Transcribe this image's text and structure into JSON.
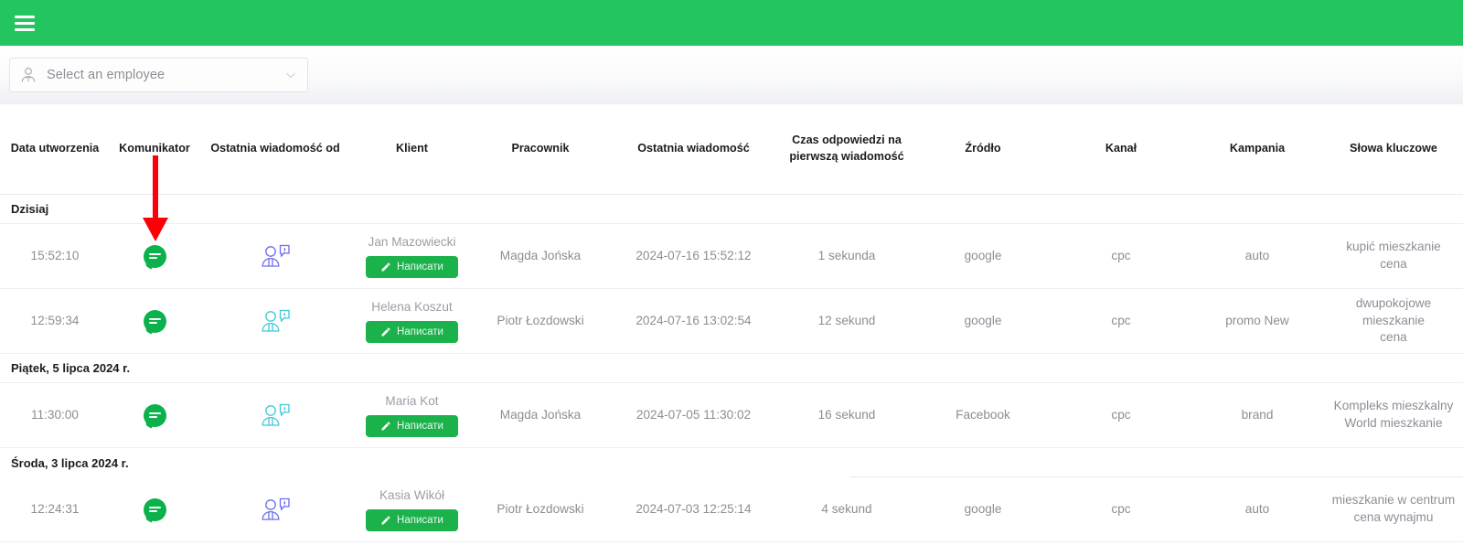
{
  "topbar": {
    "menu_icon": "hamburger-menu-icon"
  },
  "filter": {
    "employee_select": {
      "placeholder": "Select an employee",
      "icon": "employee-avatar-icon",
      "chevron": "chevron-down-icon"
    }
  },
  "table": {
    "headers": [
      "Data utworzenia",
      "Komunikator",
      "Ostatnia wiadomość od",
      "Klient",
      "Pracownik",
      "Ostatnia wiadomość",
      "Czas odpowiedzi na pierwszą wiadomość",
      "Źródło",
      "Kanał",
      "Kampania",
      "Słowa kluczowe"
    ],
    "write_button_label": "Написати",
    "groups": [
      {
        "label": "Dzisiaj",
        "rows": [
          {
            "created_time": "15:52:10",
            "messenger_icon": "green-chat-bubble-icon",
            "last_message_from_icon": "operator-speech-icon",
            "last_message_from_color": "#6b6bf0",
            "client": "Jan Mazowiecki",
            "employee": "Magda Jońska",
            "last_message": "2024-07-16 15:52:12",
            "first_response_time": "1 sekunda",
            "source": "google",
            "channel": "cpc",
            "campaign": "auto",
            "keywords": "kupić mieszkanie\ncena"
          },
          {
            "created_time": "12:59:34",
            "messenger_icon": "green-chat-bubble-icon",
            "last_message_from_icon": "client-speech-icon",
            "last_message_from_color": "#3fc8d8",
            "client": "Helena Koszut",
            "employee": "Piotr Łozdowski",
            "last_message": "2024-07-16 13:02:54",
            "first_response_time": "12 sekund",
            "source": "google",
            "channel": "cpc",
            "campaign": "promo New",
            "keywords": "dwupokojowe\nmieszkanie\ncena"
          }
        ]
      },
      {
        "label": "Piątek, 5 lipca 2024 r.",
        "rows": [
          {
            "created_time": "11:30:00",
            "messenger_icon": "green-chat-bubble-icon",
            "last_message_from_icon": "client-speech-icon",
            "last_message_from_color": "#3fc8d8",
            "client": "Maria Kot",
            "employee": "Magda Jońska",
            "last_message": "2024-07-05 11:30:02",
            "first_response_time": "16 sekund",
            "source": "Facebook",
            "channel": "cpc",
            "campaign": "brand",
            "keywords": "Kompleks mieszkalny\nWorld mieszkanie"
          }
        ]
      },
      {
        "label": "Środa, 3 lipca 2024 r.",
        "rows": [
          {
            "created_time": "12:24:31",
            "messenger_icon": "green-chat-bubble-icon",
            "last_message_from_icon": "operator-speech-icon",
            "last_message_from_color": "#6b6bf0",
            "client": "Kasia Wikół",
            "employee": "Piotr Łozdowski",
            "last_message": "2024-07-03 12:25:14",
            "first_response_time": "4 sekund",
            "source": "google",
            "channel": "cpc",
            "campaign": "auto",
            "keywords": "mieszkanie w centrum\ncena wynajmu"
          }
        ]
      }
    ]
  },
  "annotation": {
    "arrow": "red-down-arrow-annotation",
    "color": "#ff0000"
  },
  "colors": {
    "brand_green": "#22c55e",
    "button_green": "#1bb24b",
    "chat_green": "#0bb14b",
    "text_muted": "#8a8e95",
    "text_dark": "#1b1c1e"
  }
}
